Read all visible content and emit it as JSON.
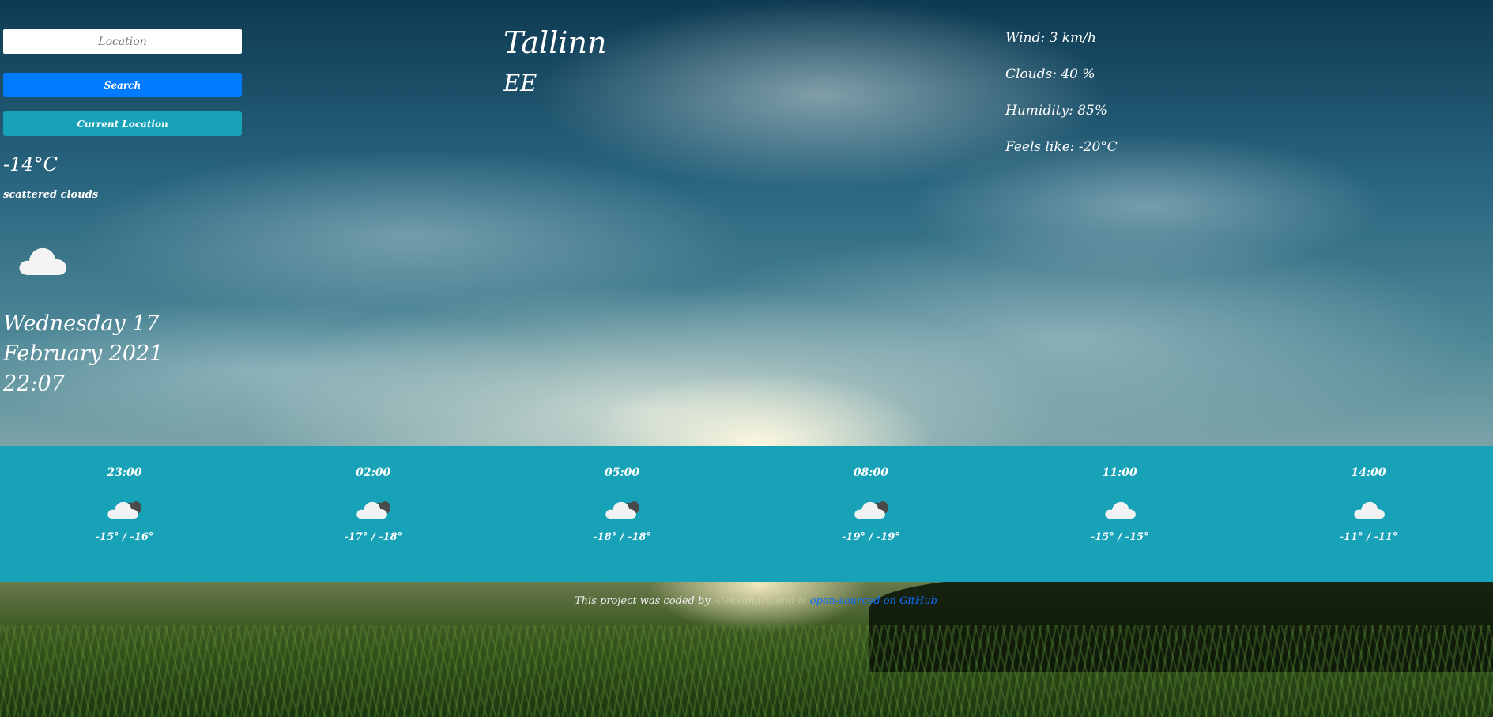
{
  "search": {
    "placeholder": "Location",
    "search_label": "Search",
    "current_location_label": "Current Location"
  },
  "current": {
    "temperature": "-14°C",
    "description": "scattered clouds",
    "icon": "cloud-icon",
    "date_line1": "Wednesday 17",
    "date_line2": "February 2021",
    "time": "22:07"
  },
  "location": {
    "city": "Tallinn",
    "country": "EE"
  },
  "details": {
    "wind": "Wind: 3 km/h",
    "clouds": "Clouds: 40 %",
    "humidity": "Humidity: 85%",
    "feels_like": "Feels like: -20°C"
  },
  "forecast": [
    {
      "time": "23:00",
      "icon": "scattered-clouds-icon",
      "temps": "-15° / -16°"
    },
    {
      "time": "02:00",
      "icon": "scattered-clouds-icon",
      "temps": "-17° / -18°"
    },
    {
      "time": "05:00",
      "icon": "scattered-clouds-icon",
      "temps": "-18° / -18°"
    },
    {
      "time": "08:00",
      "icon": "scattered-clouds-icon",
      "temps": "-19° / -19°"
    },
    {
      "time": "11:00",
      "icon": "cloud-icon",
      "temps": "-15° / -15°"
    },
    {
      "time": "14:00",
      "icon": "cloud-icon",
      "temps": "-11° / -11°"
    }
  ],
  "footer": {
    "text": "This project was coded by",
    "author": "Aleksandra",
    "middle": " and is ",
    "link_label": "open-sourced on GitHub"
  },
  "colors": {
    "search_button": "#007bff",
    "current_location_button": "#17a2b8",
    "forecast_strip": "#17a2b8",
    "link": "#0d6efd"
  }
}
